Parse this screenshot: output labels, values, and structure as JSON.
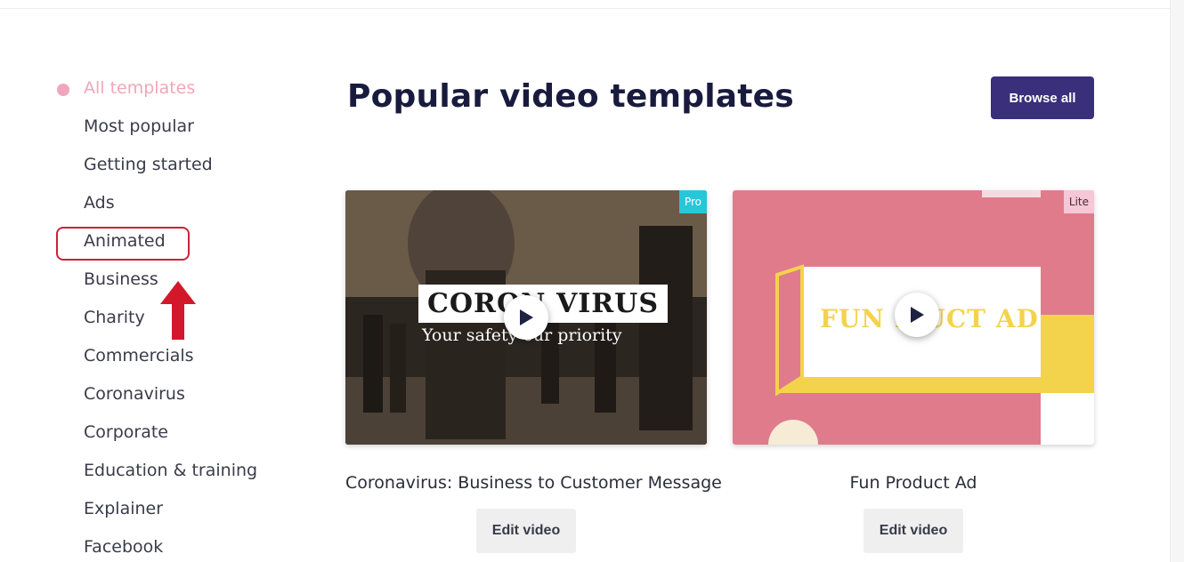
{
  "sidebar": {
    "items": [
      {
        "label": "All templates",
        "active": true
      },
      {
        "label": "Most popular"
      },
      {
        "label": "Getting started"
      },
      {
        "label": "Ads"
      },
      {
        "label": "Animated",
        "highlighted": true
      },
      {
        "label": "Business"
      },
      {
        "label": "Charity"
      },
      {
        "label": "Commercials"
      },
      {
        "label": "Coronavirus"
      },
      {
        "label": "Corporate"
      },
      {
        "label": "Education & training"
      },
      {
        "label": "Explainer"
      },
      {
        "label": "Facebook"
      }
    ]
  },
  "header": {
    "title": "Popular video templates",
    "browse_label": "Browse all"
  },
  "cards": [
    {
      "badge": "Pro",
      "thumb_heading": "CORON VIRUS",
      "thumb_subheading": "Your safety our priority",
      "title": "Coronavirus: Business to Customer Message",
      "edit_label": "Edit video"
    },
    {
      "badge": "Lite",
      "thumb_heading": "FUN P UCT AD",
      "title": "Fun Product Ad",
      "edit_label": "Edit video"
    }
  ],
  "colors": {
    "accent_pink": "#f0a6bb",
    "button_purple": "#3a2f7a",
    "pro_badge": "#27c6d9",
    "lite_badge": "#f6c7d6",
    "annotation_red": "#c8233a"
  },
  "icons": {
    "active_marker": "dot-icon",
    "play": "play-icon",
    "annotation": "red-arrow-icon"
  }
}
